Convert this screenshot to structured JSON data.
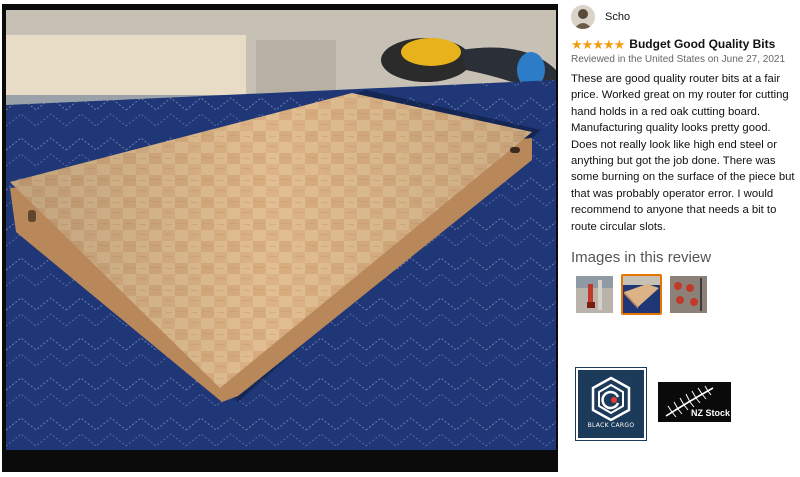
{
  "review": {
    "reviewer_name": "Scho",
    "rating": 5,
    "title": "Budget Good Quality Bits",
    "date": "Reviewed in the United States on June 27, 2021",
    "body": "These are good quality router bits at a fair price. Worked great on my router for cutting hand holds in a red oak cutting board. Manufacturing quality looks pretty good. Does not really look like high end steel or anything but got the job done. There was some burning on the surface of the piece but that was probably operator error. I would recommend to anyone that needs a bit to route circular slots.",
    "images_heading": "Images in this review",
    "thumbnails": [
      {
        "subject": "router-bit",
        "selected": false
      },
      {
        "subject": "cutting-board",
        "selected": true
      },
      {
        "subject": "router-bits-set",
        "selected": false
      }
    ]
  },
  "photo": {
    "subject": "red oak end-grain cutting board on blue moving blanket"
  },
  "logos": {
    "black_cargo": "BLACK CARGO",
    "nz_stock": "NZ Stock"
  },
  "colors": {
    "star": "#f39c12",
    "selected_thumb_border": "#e77600",
    "blanket_blue": "#1d3370",
    "wood": "#d9ad7c"
  }
}
